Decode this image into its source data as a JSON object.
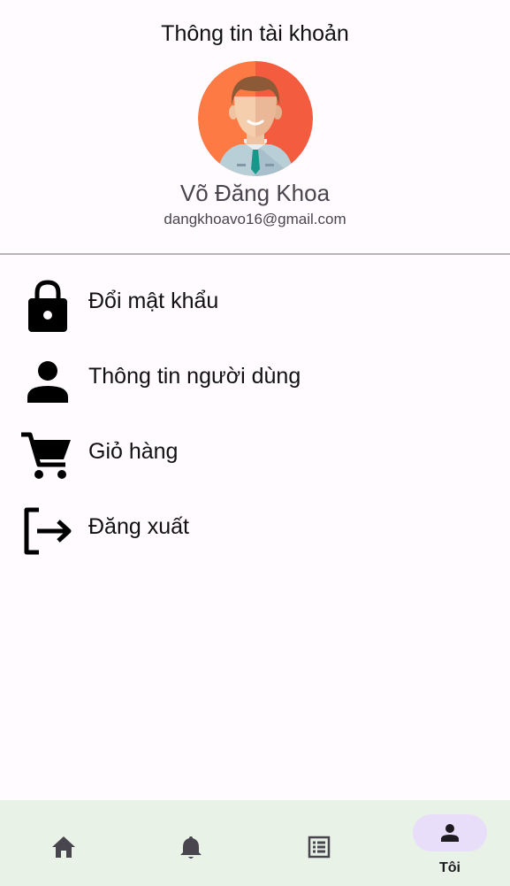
{
  "header": {
    "title": "Thông tin tài khoản",
    "user_name": "Võ Đăng Khoa",
    "user_email": "dangkhoavo16@gmail.com"
  },
  "menu": {
    "items": [
      {
        "label": "Đổi mật khẩu",
        "icon": "lock-icon"
      },
      {
        "label": "Thông tin người dùng",
        "icon": "person-icon"
      },
      {
        "label": "Giỏ hàng",
        "icon": "cart-icon"
      },
      {
        "label": "Đăng xuất",
        "icon": "logout-icon"
      }
    ]
  },
  "bottom_nav": {
    "items": [
      {
        "icon": "home-icon",
        "label": ""
      },
      {
        "icon": "bell-icon",
        "label": ""
      },
      {
        "icon": "list-icon",
        "label": ""
      },
      {
        "icon": "person-icon",
        "label": "Tôi",
        "active": true
      }
    ]
  },
  "colors": {
    "background": "#fffbfe",
    "nav_background": "#e8f2e6",
    "nav_active_pill": "#e9def9",
    "avatar_orange_left": "#fe7a45",
    "avatar_orange_right": "#f45c40",
    "secondary_text": "#49454f"
  }
}
